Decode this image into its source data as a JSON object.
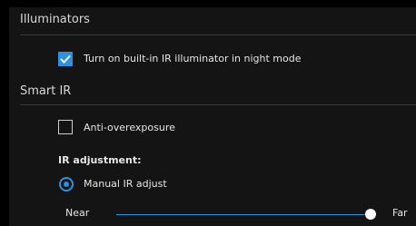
{
  "illuminators": {
    "title": "Illuminators",
    "night_ir_label": "Turn on built-in IR illuminator in night mode",
    "night_ir_checked": true
  },
  "smart_ir": {
    "title": "Smart IR",
    "anti_overexposure_label": "Anti-overexposure",
    "anti_overexposure_checked": false,
    "ir_adjustment_label": "IR adjustment:",
    "manual_ir_label": "Manual IR adjust",
    "manual_ir_selected": true,
    "slider": {
      "min_label": "Near",
      "max_label": "Far",
      "value_fraction": 1.0
    }
  },
  "colors": {
    "accent": "#2f8fe0",
    "panel_bg": "#141414",
    "text": "#e6e6e6"
  }
}
